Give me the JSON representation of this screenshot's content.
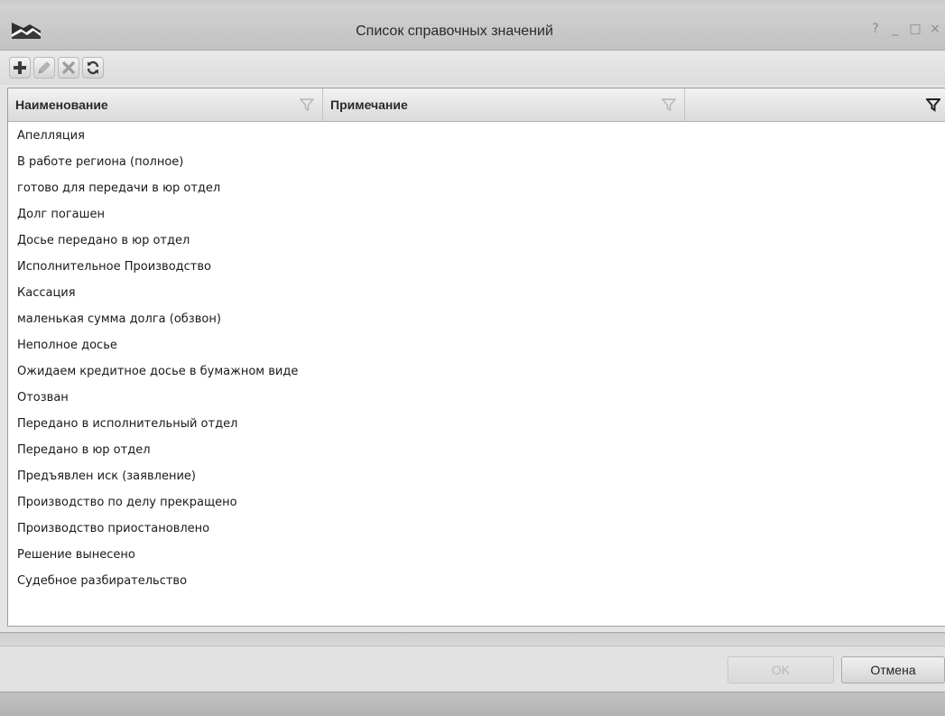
{
  "window": {
    "title": "Список справочных значений",
    "controls": {
      "help": "?",
      "minimize": "_",
      "maximize": "□",
      "close": "×"
    }
  },
  "toolbar": {
    "buttons": [
      {
        "name": "add-button",
        "icon": "plus-icon",
        "enabled": true
      },
      {
        "name": "edit-button",
        "icon": "pencil-icon",
        "enabled": false
      },
      {
        "name": "delete-button",
        "icon": "cross-icon",
        "enabled": false
      },
      {
        "name": "refresh-button",
        "icon": "refresh-icon",
        "enabled": true
      }
    ]
  },
  "grid": {
    "columns": [
      {
        "label": "Наименование",
        "filter_active": false
      },
      {
        "label": "Примечание",
        "filter_active": false
      },
      {
        "label": "",
        "filter_active": true
      }
    ],
    "rows": [
      "Апелляция",
      "В работе региона (полное)",
      "готово для передачи в юр отдел",
      "Долг погашен",
      "Досье передано в юр отдел",
      "Исполнительное Производство",
      "Кассация",
      "маленькая сумма долга (обзвон)",
      "Неполное досье",
      "Ожидаем кредитное досье в бумажном виде",
      "Отозван",
      "Передано в исполнительный отдел",
      "Передано в юр отдел",
      "Предъявлен иск (заявление)",
      "Производство по делу прекращено",
      "Производство приостановлено",
      "Решение вынесено",
      "Судебное разбирательство"
    ]
  },
  "footer": {
    "ok_label": "OK",
    "ok_enabled": false,
    "cancel_label": "Отмена"
  },
  "colors": {
    "window_bg": "#e4e4e4",
    "add_icon": "#3a3a3a",
    "disabled_icon": "#b0b0b0",
    "active_filter": "#222222",
    "inactive_filter": "#b5b5b5"
  }
}
